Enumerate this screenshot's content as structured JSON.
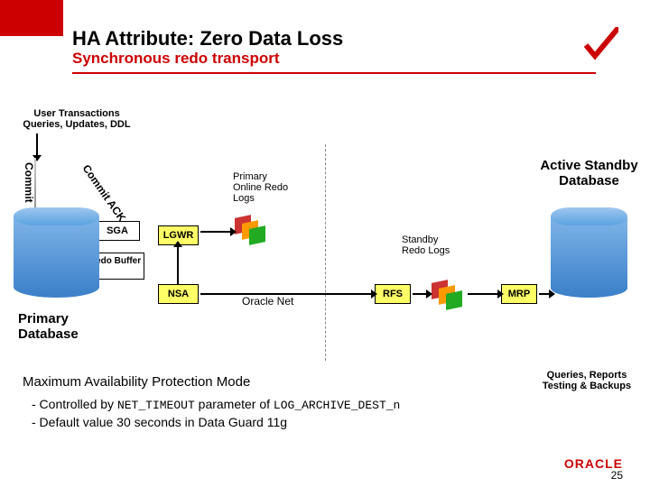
{
  "header": {
    "title": "HA Attribute: Zero Data Loss",
    "subtitle": "Synchronous redo transport"
  },
  "labels": {
    "user_transactions": "User Transactions Queries, Updates, DDL",
    "commit": "Commit",
    "commit_ack": "Commit ACK",
    "sga": "SGA",
    "redo_buffer": "Redo Buffer",
    "lgwr": "LGWR",
    "nsa": "NSA",
    "rfs": "RFS",
    "mrp": "MRP",
    "primary_online_redo": "Primary Online Redo Logs",
    "standby_redo": "Standby Redo Logs",
    "active_standby": "Active Standby Database",
    "primary_db": "Primary Database",
    "oracle_net": "Oracle   Net",
    "queries": "Queries, Reports Testing & Backups",
    "max_avail": "Maximum Availability Protection Mode",
    "bullet1_pre": "- Controlled by ",
    "bullet1_code1": "NET_TIMEOUT",
    "bullet1_mid": " parameter of ",
    "bullet1_code2": "LOG_ARCHIVE_DEST_n",
    "bullet2": "- Default value 30 seconds in Data Guard 11g"
  },
  "footer": {
    "logo": "ORACLE",
    "page": "25"
  }
}
